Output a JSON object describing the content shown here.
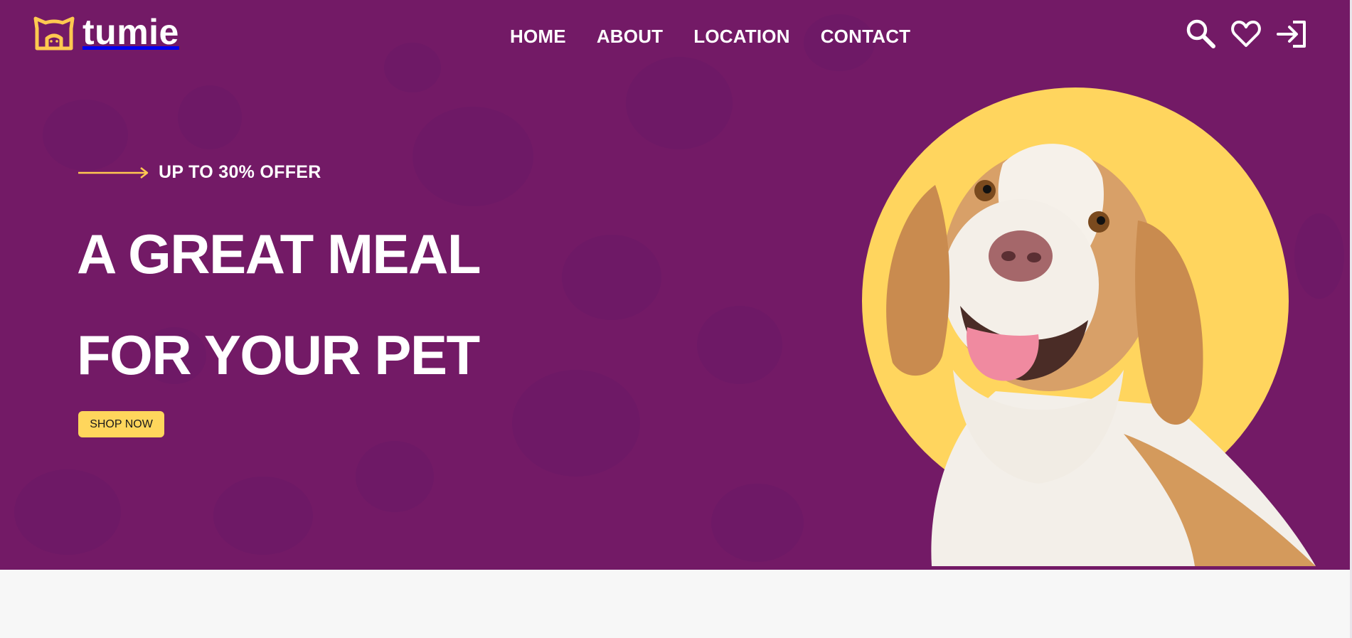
{
  "brand": {
    "name": "tumie",
    "logo_icon": "cat-house-icon"
  },
  "nav": {
    "items": [
      "HOME",
      "ABOUT",
      "LOCATION",
      "CONTACT"
    ]
  },
  "header_actions": {
    "icons": [
      "search-icon",
      "heart-icon",
      "login-icon"
    ]
  },
  "hero": {
    "offer": "UP TO 30% OFFER",
    "headline_line1": "A GREAT MEAL",
    "headline_line2": "FOR YOUR PET",
    "cta_label": "SHOP NOW",
    "image": "dog-photo"
  },
  "colors": {
    "hero_background": "#731a66",
    "accent_yellow": "#ffd55e",
    "text_white": "#ffffff",
    "page_background": "#f7f7f7"
  }
}
